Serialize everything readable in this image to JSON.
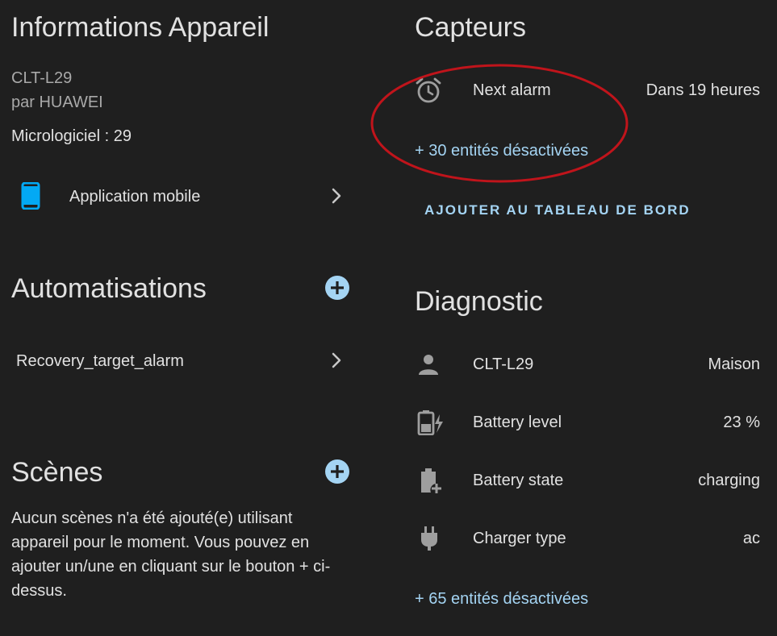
{
  "device_info": {
    "title": "Informations Appareil",
    "model": "CLT-L29",
    "manufacturer": "par HUAWEI",
    "firmware": "Micrologiciel : 29",
    "integration": {
      "label": "Application mobile",
      "icon": "mobile-phone-icon"
    }
  },
  "automations": {
    "title": "Automatisations",
    "items": [
      {
        "label": "Recovery_target_alarm"
      }
    ]
  },
  "scenes": {
    "title": "Scènes",
    "empty_message": "Aucun scènes n'a été ajouté(e) utilisant appareil pour le moment. Vous pouvez en ajouter un/une en cliquant sur le bouton + ci-dessus."
  },
  "sensors": {
    "title": "Capteurs",
    "items": [
      {
        "label": "Next alarm",
        "value": "Dans 19 heures",
        "icon": "alarm-clock-icon"
      }
    ],
    "disabled_link": "+ 30 entités désactivées",
    "add_to_dashboard": "AJOUTER AU TABLEAU DE BORD"
  },
  "diagnostic": {
    "title": "Diagnostic",
    "items": [
      {
        "label": "CLT-L29",
        "value": "Maison",
        "icon": "person-icon"
      },
      {
        "label": "Battery level",
        "value": "23 %",
        "icon": "battery-charging-icon"
      },
      {
        "label": "Battery state",
        "value": "charging",
        "icon": "battery-plus-icon"
      },
      {
        "label": "Charger type",
        "value": "ac",
        "icon": "power-plug-icon"
      }
    ],
    "disabled_link": "+ 65 entités désactivées"
  },
  "colors": {
    "background": "#1f1f1f",
    "accent": "#a4d4f3",
    "phone_icon": "#03a9f4",
    "annotation": "#c0141b"
  }
}
